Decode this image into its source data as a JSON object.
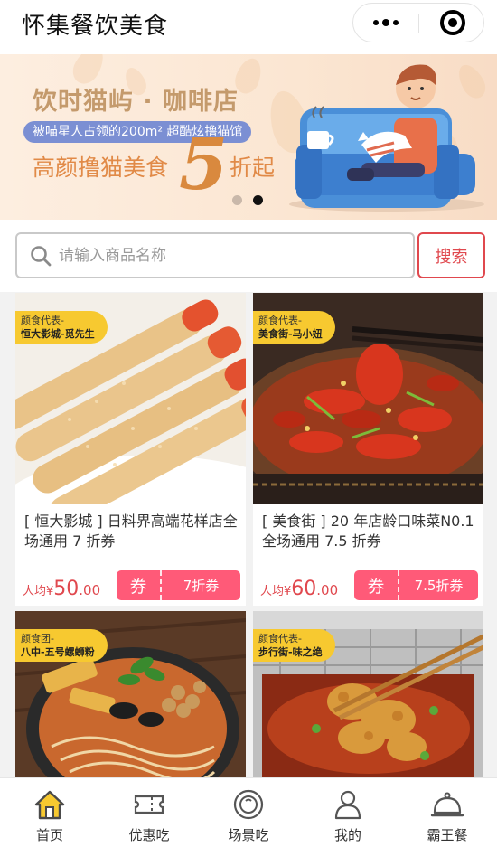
{
  "header": {
    "title": "怀集餐饮美食"
  },
  "banner": {
    "title": "饮时猫屿 · 咖啡店",
    "subtitle": "被喵星人占领的200m² 超酷炫撸猫馆",
    "slogan": "高颜撸猫美食",
    "big_number": "5",
    "suffix": "折起",
    "active_dot": 2
  },
  "search": {
    "placeholder": "请输入商品名称",
    "button_label": "搜索"
  },
  "cards": [
    {
      "tag_line1": "颜食代表-",
      "tag_line2": "恒大影城-觅先生",
      "desc": "[ 恒大影城 ] 日料界高端花样店全场通用 7 折券",
      "price_prefix": "人均¥",
      "price_int": "50",
      "price_dec": ".00",
      "coupon_left": "券",
      "coupon_right": "7折券"
    },
    {
      "tag_line1": "颜食代表-",
      "tag_line2": "美食街-马小妞",
      "desc": "[ 美食街 ] 20 年店龄口味菜N0.1 全场通用 7.5 折券",
      "price_prefix": "人均¥",
      "price_int": "60",
      "price_dec": ".00",
      "coupon_left": "券",
      "coupon_right": "7.5折券"
    },
    {
      "tag_line1": "颜食团-",
      "tag_line2": "八中-五号螺蛳粉"
    },
    {
      "tag_line1": "颜食代表-",
      "tag_line2": "步行街-味之绝"
    }
  ],
  "tabbar": [
    {
      "label": "首页",
      "icon": "home-icon",
      "active": true
    },
    {
      "label": "优惠吃",
      "icon": "ticket-icon",
      "active": false
    },
    {
      "label": "场景吃",
      "icon": "plate-icon",
      "active": false
    },
    {
      "label": "我的",
      "icon": "user-icon",
      "active": false
    },
    {
      "label": "霸王餐",
      "icon": "cloche-icon",
      "active": false
    }
  ],
  "colors": {
    "accent": "#e0484e",
    "coupon": "#ff5a78",
    "tag": "#f7c930",
    "home_active": "#f7c930"
  }
}
